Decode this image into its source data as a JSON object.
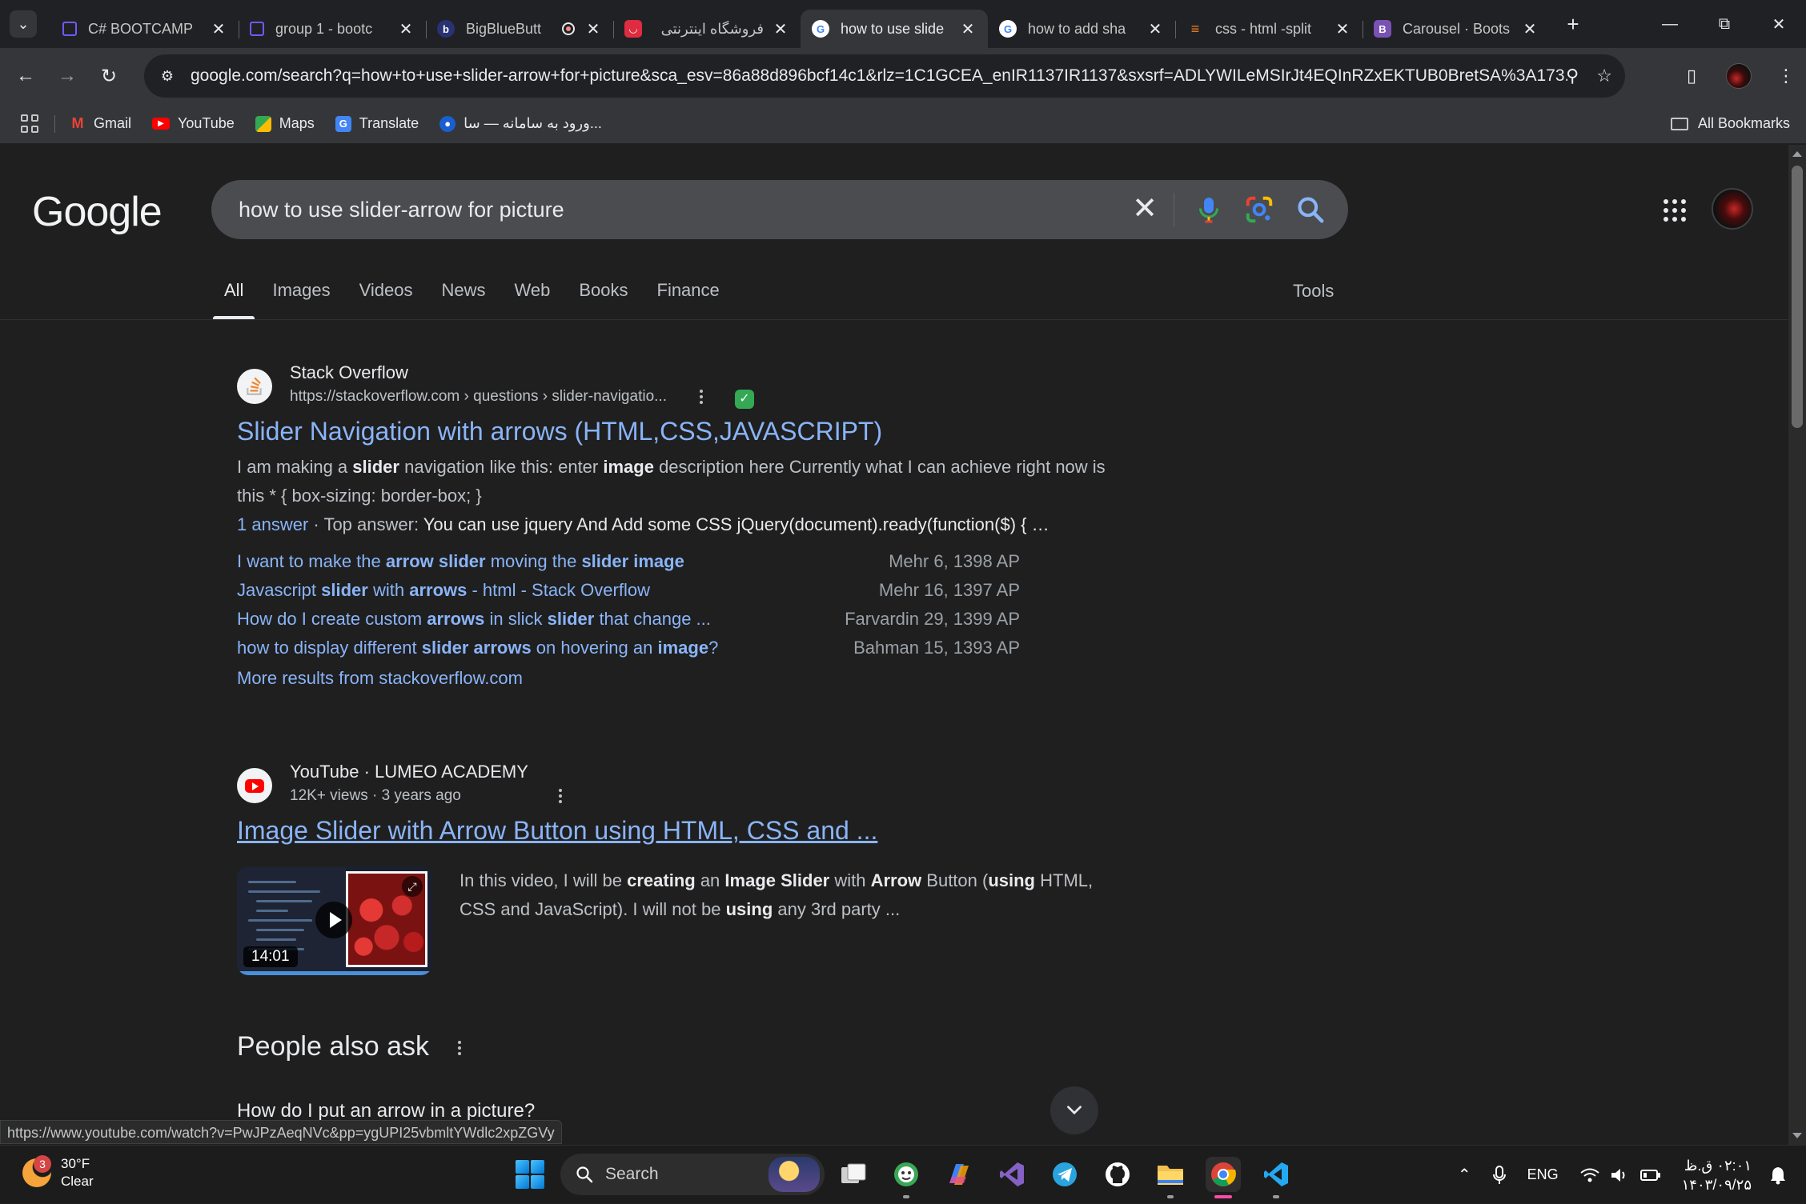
{
  "browser": {
    "tabs": [
      {
        "title": "C# BOOTCAMP",
        "favicon": "purple-square-icon",
        "color": "#5a4bd1"
      },
      {
        "title": "group 1 - bootc",
        "favicon": "purple-square-icon",
        "color": "#5a4bd1"
      },
      {
        "title": "BigBlueButt",
        "favicon": "bigbluebutton-icon",
        "color": "#283274",
        "recording": true
      },
      {
        "title": "فروشگاه اینترنتی",
        "favicon": "shop-icon",
        "color": "#e02c40"
      },
      {
        "title": "how to use slide",
        "favicon": "google-icon",
        "active": true
      },
      {
        "title": "how to add sha",
        "favicon": "google-icon"
      },
      {
        "title": "css - html -split",
        "favicon": "stackoverflow-icon"
      },
      {
        "title": "Carousel · Boots",
        "favicon": "bootstrap-icon",
        "color": "#7952b3"
      }
    ],
    "address": "google.com/search?q=how+to+use+slider-arrow+for+picture&sca_esv=86a88d896bcf14c1&rlz=1C1GCEA_enIR1137IR1137&sxsrf=ADLYWILeMSIrJt4EQInRZxEKTUB0BretSA%3A173...",
    "bookmarks": [
      {
        "label": "Gmail",
        "icon": "gmail-icon"
      },
      {
        "label": "YouTube",
        "icon": "youtube-icon"
      },
      {
        "label": "Maps",
        "icon": "maps-icon"
      },
      {
        "label": "Translate",
        "icon": "translate-icon"
      },
      {
        "label": "ورود به سامانه — سا...",
        "icon": "globe-icon"
      }
    ],
    "all_bookmarks": "All Bookmarks"
  },
  "google": {
    "logo": "Google",
    "query": "how to use slider-arrow for picture",
    "tabs": [
      "All",
      "Images",
      "Videos",
      "News",
      "Web",
      "Books",
      "Finance"
    ],
    "active_tab": "All",
    "tools": "Tools"
  },
  "result1": {
    "source": "Stack Overflow",
    "url": "https://stackoverflow.com › questions › slider-navigatio...",
    "title": "Slider Navigation with arrows (HTML,CSS,JAVASCRIPT)",
    "snippet_parts": {
      "p1": "I am making a ",
      "b1": "slider",
      "p2": " navigation like this: enter ",
      "b2": "image",
      "p3": " description here Currently what I can achieve right now is this * { box-sizing: border-box; }"
    },
    "answers": "1 answer",
    "top_answer_label": "Top answer:",
    "top_answer": "You can use jquery And Add some CSS jQuery(document).ready(function($) { …",
    "sub_links": [
      {
        "parts": [
          "I want to make the ",
          "arrow slider",
          " moving the ",
          "slider image",
          ""
        ],
        "date": "Mehr 6, 1398 AP"
      },
      {
        "parts": [
          "Javascript ",
          "slider",
          " with ",
          "arrows",
          " - html - Stack Overflow"
        ],
        "date": "Mehr 16, 1397 AP"
      },
      {
        "parts": [
          "How do I create custom ",
          "arrows",
          " in slick ",
          "slider",
          " that change ..."
        ],
        "date": "Farvardin 29, 1399 AP"
      },
      {
        "parts": [
          "how to display different ",
          "slider arrows",
          " on hovering an ",
          "image",
          "?"
        ],
        "date": "Bahman 15, 1393 AP"
      }
    ],
    "more": "More results from stackoverflow.com"
  },
  "result2": {
    "source": "YouTube · LUMEO ACADEMY",
    "meta": "12K+ views · 3 years ago",
    "title": "Image Slider with Arrow Button using HTML, CSS and ...",
    "duration": "14:01",
    "snippet_parts": {
      "p1": "In this video, I will be ",
      "b1": "creating",
      "p2": " an ",
      "b2": "Image Slider",
      "p3": " with ",
      "b3": "Arrow",
      "p4": " Button (",
      "b4": "using",
      "p5": " HTML, CSS and JavaScript). I will not be ",
      "b5": "using",
      "p6": " any 3rd party ..."
    }
  },
  "people_also_ask": {
    "heading": "People also ask",
    "first_question": "How do I put an arrow in a picture?"
  },
  "status_url": "https://www.youtube.com/watch?v=PwJPzAeqNVc&pp=ygUPI25vbmltYWdlc2xpZGVy",
  "taskbar": {
    "weather_temp": "30°F",
    "weather_desc": "Clear",
    "weather_badge": "3",
    "search": "Search",
    "apps": [
      "file-explorer-icon",
      "copilot-icon",
      "visual-studio-icon",
      "telegram-icon",
      "github-icon",
      "folder-icon",
      "chrome-icon",
      "vscode-icon"
    ],
    "lang": "ENG",
    "time": "۰۲:۰۱ ق.ظ",
    "date": "۱۴۰۳/۰۹/۲۵"
  }
}
